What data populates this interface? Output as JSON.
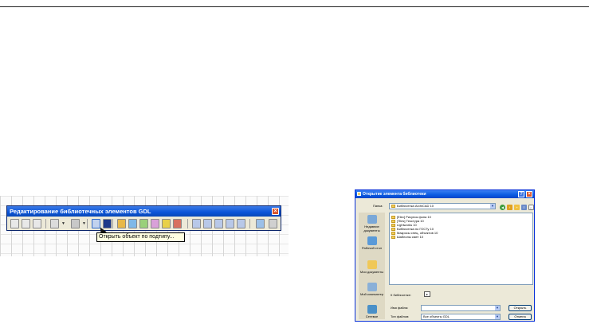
{
  "toolbar": {
    "title": "Редактирование библиотечных элементов GDL",
    "close_glyph": "×",
    "tooltip": "Открыть объект по подтипу...",
    "buttons": [
      {
        "name": "new-object-icon",
        "color": "#e8e8e8"
      },
      {
        "name": "open-object-icon",
        "color": "#e8e8e8"
      },
      {
        "name": "save-object-icon",
        "color": "#e8e8e8"
      },
      {
        "name": "object-settings-icon",
        "color": "#dcdcdc"
      },
      {
        "name": "component-icon",
        "color": "#c8c8c8"
      },
      {
        "name": "open-by-subtype-icon",
        "color": "#c1d2ee"
      },
      {
        "name": "save-disk-icon",
        "color": "#1f3a8a"
      },
      {
        "name": "symbol-2d-icon",
        "color": "#e8b848"
      },
      {
        "name": "view-3d-icon",
        "color": "#7fb8e8"
      },
      {
        "name": "preview-icon",
        "color": "#9ad07a"
      },
      {
        "name": "script-icon",
        "color": "#d9a0d9"
      },
      {
        "name": "properties-icon",
        "color": "#e8d048"
      },
      {
        "name": "parameters-icon",
        "color": "#d87060"
      },
      {
        "name": "align-left-icon",
        "color": "#b8c8e8"
      },
      {
        "name": "align-center-icon",
        "color": "#b8c8e8"
      },
      {
        "name": "align-right-icon",
        "color": "#b8c8e8"
      },
      {
        "name": "distribute-icon",
        "color": "#b8c8e8"
      },
      {
        "name": "arrange-icon",
        "color": "#b8c8e8"
      },
      {
        "name": "library-manager-icon",
        "color": "#9cc0e8"
      },
      {
        "name": "help-icon",
        "color": "#d0d0d0"
      }
    ]
  },
  "dialog": {
    "title": "Открытие элемента библиотеки",
    "help_glyph": "?",
    "close_glyph": "×",
    "folder_label": "Папка:",
    "folder_value": "Библиотека ArchiCAD 10",
    "places": [
      {
        "name": "recent-documents",
        "label": "Недавние документы",
        "color": "#7aa8d8"
      },
      {
        "name": "desktop",
        "label": "Рабочий стол",
        "color": "#5a9ad8"
      },
      {
        "name": "my-documents",
        "label": "Мои документы",
        "color": "#f0c858"
      },
      {
        "name": "my-computer",
        "label": "Мой компьютер",
        "color": "#8ab0d8"
      },
      {
        "name": "network",
        "label": "Сетевое",
        "color": "#4a90c8"
      }
    ],
    "files": [
      "[Elec] Рисунок фона 10",
      "[Tiles] Текстура 10",
      "Lightworks 10",
      "Библиотека по ГОСТу 10",
      "Макросы спец. объектов 10",
      "Шаблоны смет 10"
    ],
    "to_library_label": "К библиотеке:",
    "filename_label": "Имя файла:",
    "filename_value": "",
    "filetype_label": "Тип файлов:",
    "filetype_value": "Все объекты GDL",
    "open_button": "Открыть",
    "cancel_button": "Отмена"
  }
}
